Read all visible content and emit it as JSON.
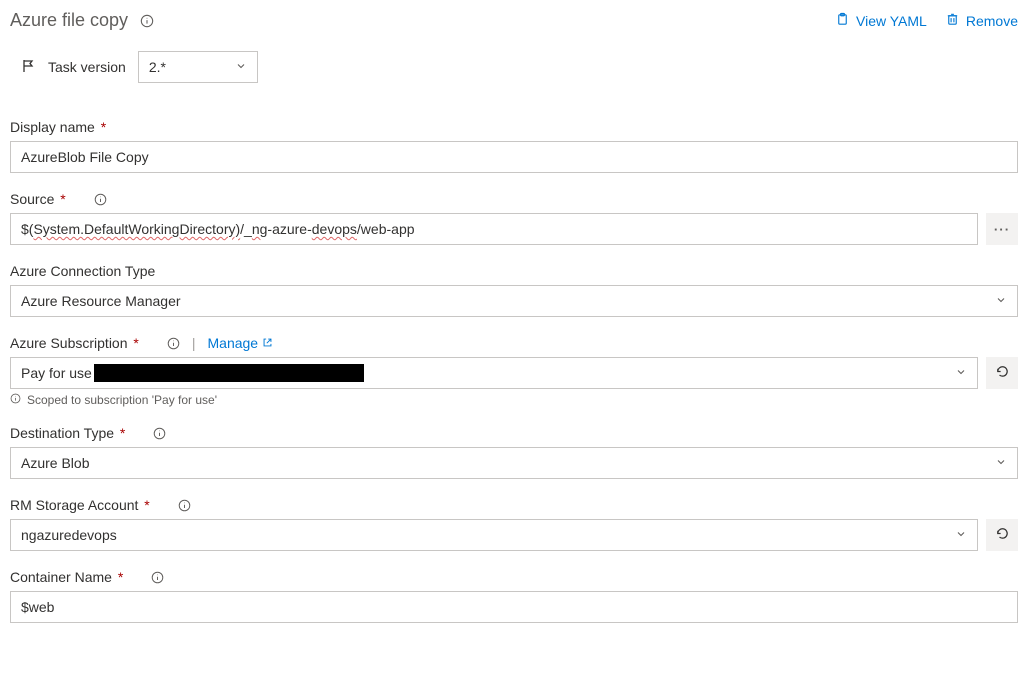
{
  "header": {
    "title": "Azure file copy",
    "view_yaml": "View YAML",
    "remove": "Remove"
  },
  "task_version": {
    "label": "Task version",
    "value": "2.*"
  },
  "fields": {
    "display_name": {
      "label": "Display name",
      "value": "AzureBlob File Copy"
    },
    "source": {
      "label": "Source",
      "value_plain": "$(System.DefaultWorkingDirectory)/_ng-azure-devops/web-app",
      "value_part1": "$(",
      "value_part2": "System.DefaultWorkingDirectory)",
      "value_part3": "/_",
      "value_part4": "ng",
      "value_part5": "-azure-",
      "value_part6": "devops",
      "value_part7": "/web-app"
    },
    "connection_type": {
      "label": "Azure Connection Type",
      "value": "Azure Resource Manager"
    },
    "subscription": {
      "label": "Azure Subscription",
      "manage_label": "Manage",
      "value_prefix": "Pay for use",
      "scope_hint": "Scoped to subscription 'Pay for use'"
    },
    "destination_type": {
      "label": "Destination Type",
      "value": "Azure Blob"
    },
    "storage_account": {
      "label": "RM Storage Account",
      "value": "ngazuredevops"
    },
    "container_name": {
      "label": "Container Name",
      "value": "$web"
    }
  }
}
